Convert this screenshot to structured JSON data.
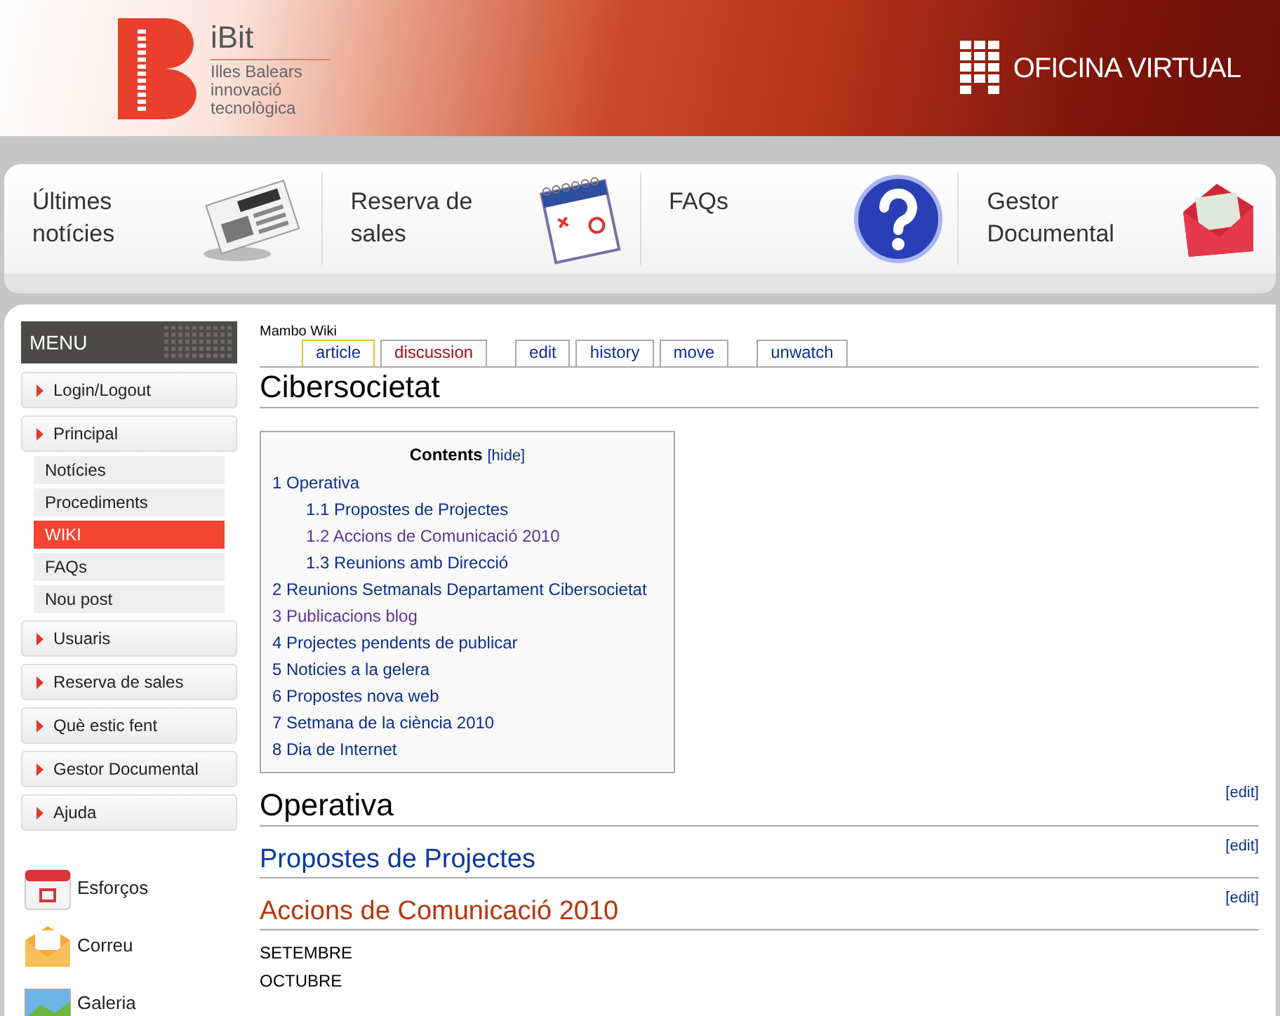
{
  "header": {
    "logo_name": "iBit",
    "logo_lines": [
      "Illes Balears",
      "innovació",
      "tecnològica"
    ],
    "portal_title": "OFICINA VIRTUAL"
  },
  "nav": [
    {
      "label": "Últimes notícies",
      "kind": "newspaper"
    },
    {
      "label": "Reserva de sales",
      "kind": "calendar"
    },
    {
      "label": "FAQs",
      "kind": "question"
    },
    {
      "label": "Gestor Documental",
      "kind": "envelope"
    }
  ],
  "sidebar": {
    "title": "MENU",
    "items": [
      {
        "label": "Login/Logout"
      },
      {
        "label": "Principal",
        "children": [
          {
            "label": "Notícies",
            "selected": false
          },
          {
            "label": "Procediments",
            "selected": false
          },
          {
            "label": "WIKI",
            "selected": true
          },
          {
            "label": "FAQs",
            "selected": false
          },
          {
            "label": "Nou post",
            "selected": false
          }
        ]
      },
      {
        "label": "Usuaris"
      },
      {
        "label": "Reserva de sales"
      },
      {
        "label": "Què estic fent"
      },
      {
        "label": "Gestor Documental"
      },
      {
        "label": "Ajuda"
      }
    ],
    "links": [
      {
        "label": "Esforços",
        "kind": "calendar"
      },
      {
        "label": "Correu",
        "kind": "mail"
      },
      {
        "label": "Galeria",
        "kind": "picture"
      }
    ]
  },
  "wiki": {
    "site": "Mambo Wiki",
    "tab_groups": [
      [
        {
          "label": "article",
          "selected": true,
          "missing": false
        },
        {
          "label": "discussion",
          "selected": false,
          "missing": true
        }
      ],
      [
        {
          "label": "edit",
          "selected": false,
          "missing": false
        },
        {
          "label": "history",
          "selected": false,
          "missing": false
        },
        {
          "label": "move",
          "selected": false,
          "missing": false
        }
      ],
      [
        {
          "label": "unwatch",
          "selected": false,
          "missing": false
        }
      ]
    ],
    "title": "Cibersocietat",
    "toc": {
      "title": "Contents",
      "toggle": "[hide]",
      "entries": [
        {
          "label": "1 Operativa",
          "visited": false,
          "children": [
            {
              "label": "1.1 Propostes de Projectes",
              "visited": false
            },
            {
              "label": "1.2 Accions de Comunicació 2010",
              "visited": true
            },
            {
              "label": "1.3 Reunions amb Direcció",
              "visited": false
            }
          ]
        },
        {
          "label": "2 Reunions Setmanals Departament Cibersocietat",
          "visited": false
        },
        {
          "label": "3 Publicacions blog",
          "visited": true
        },
        {
          "label": "4 Projectes pendents de publicar",
          "visited": false
        },
        {
          "label": "5 Noticies a la gelera",
          "visited": false
        },
        {
          "label": "6 Propostes nova web",
          "visited": false
        },
        {
          "label": "7 Setmana de la ciència 2010",
          "visited": false
        },
        {
          "label": "8 Dia de Internet",
          "visited": false
        }
      ]
    },
    "sections": [
      {
        "kind": "h1",
        "title": "Operativa",
        "color": "#000000",
        "edit": "[edit]"
      },
      {
        "kind": "h2",
        "title": "Propostes de Projectes",
        "color": "#0b3a9c",
        "edit": "[edit]"
      },
      {
        "kind": "h2",
        "title": "Accions de Comunicació 2010",
        "color": "#b8360e",
        "edit": "[edit]"
      }
    ],
    "paragraphs": [
      "SETEMBRE",
      "OCTUBRE"
    ]
  }
}
